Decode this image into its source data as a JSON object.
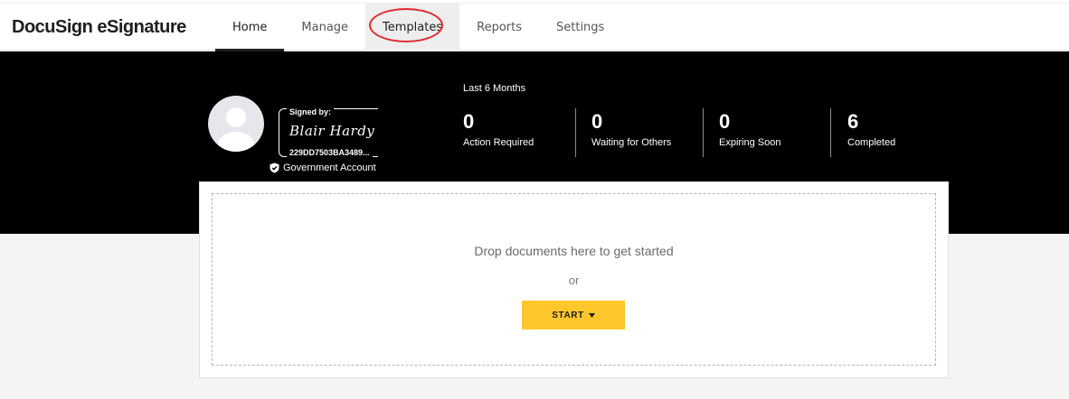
{
  "app": {
    "brand": "DocuSign eSignature"
  },
  "nav": {
    "items": [
      {
        "label": "Home"
      },
      {
        "label": "Manage"
      },
      {
        "label": "Templates"
      },
      {
        "label": "Reports"
      },
      {
        "label": "Settings"
      }
    ],
    "active": "Home"
  },
  "profile": {
    "signed_by_label": "Signed by:",
    "signature": "Blair Hardy",
    "signature_id": "229DD7503BA3489...",
    "account_type": "Government Account",
    "account_icon": "shield-check-icon",
    "avatar_icon": "user-avatar-icon"
  },
  "stats": {
    "period": "Last 6 Months",
    "items": [
      {
        "value": "0",
        "label": "Action Required"
      },
      {
        "value": "0",
        "label": "Waiting for Others"
      },
      {
        "value": "0",
        "label": "Expiring Soon"
      },
      {
        "value": "6",
        "label": "Completed"
      }
    ]
  },
  "dropzone": {
    "prompt": "Drop documents here to get started",
    "or": "or",
    "start_label": "START",
    "start_icon": "caret-down-icon"
  },
  "colors": {
    "accent": "#ffc72c",
    "hero_background": "#000000",
    "annotation": "#e3262c"
  }
}
